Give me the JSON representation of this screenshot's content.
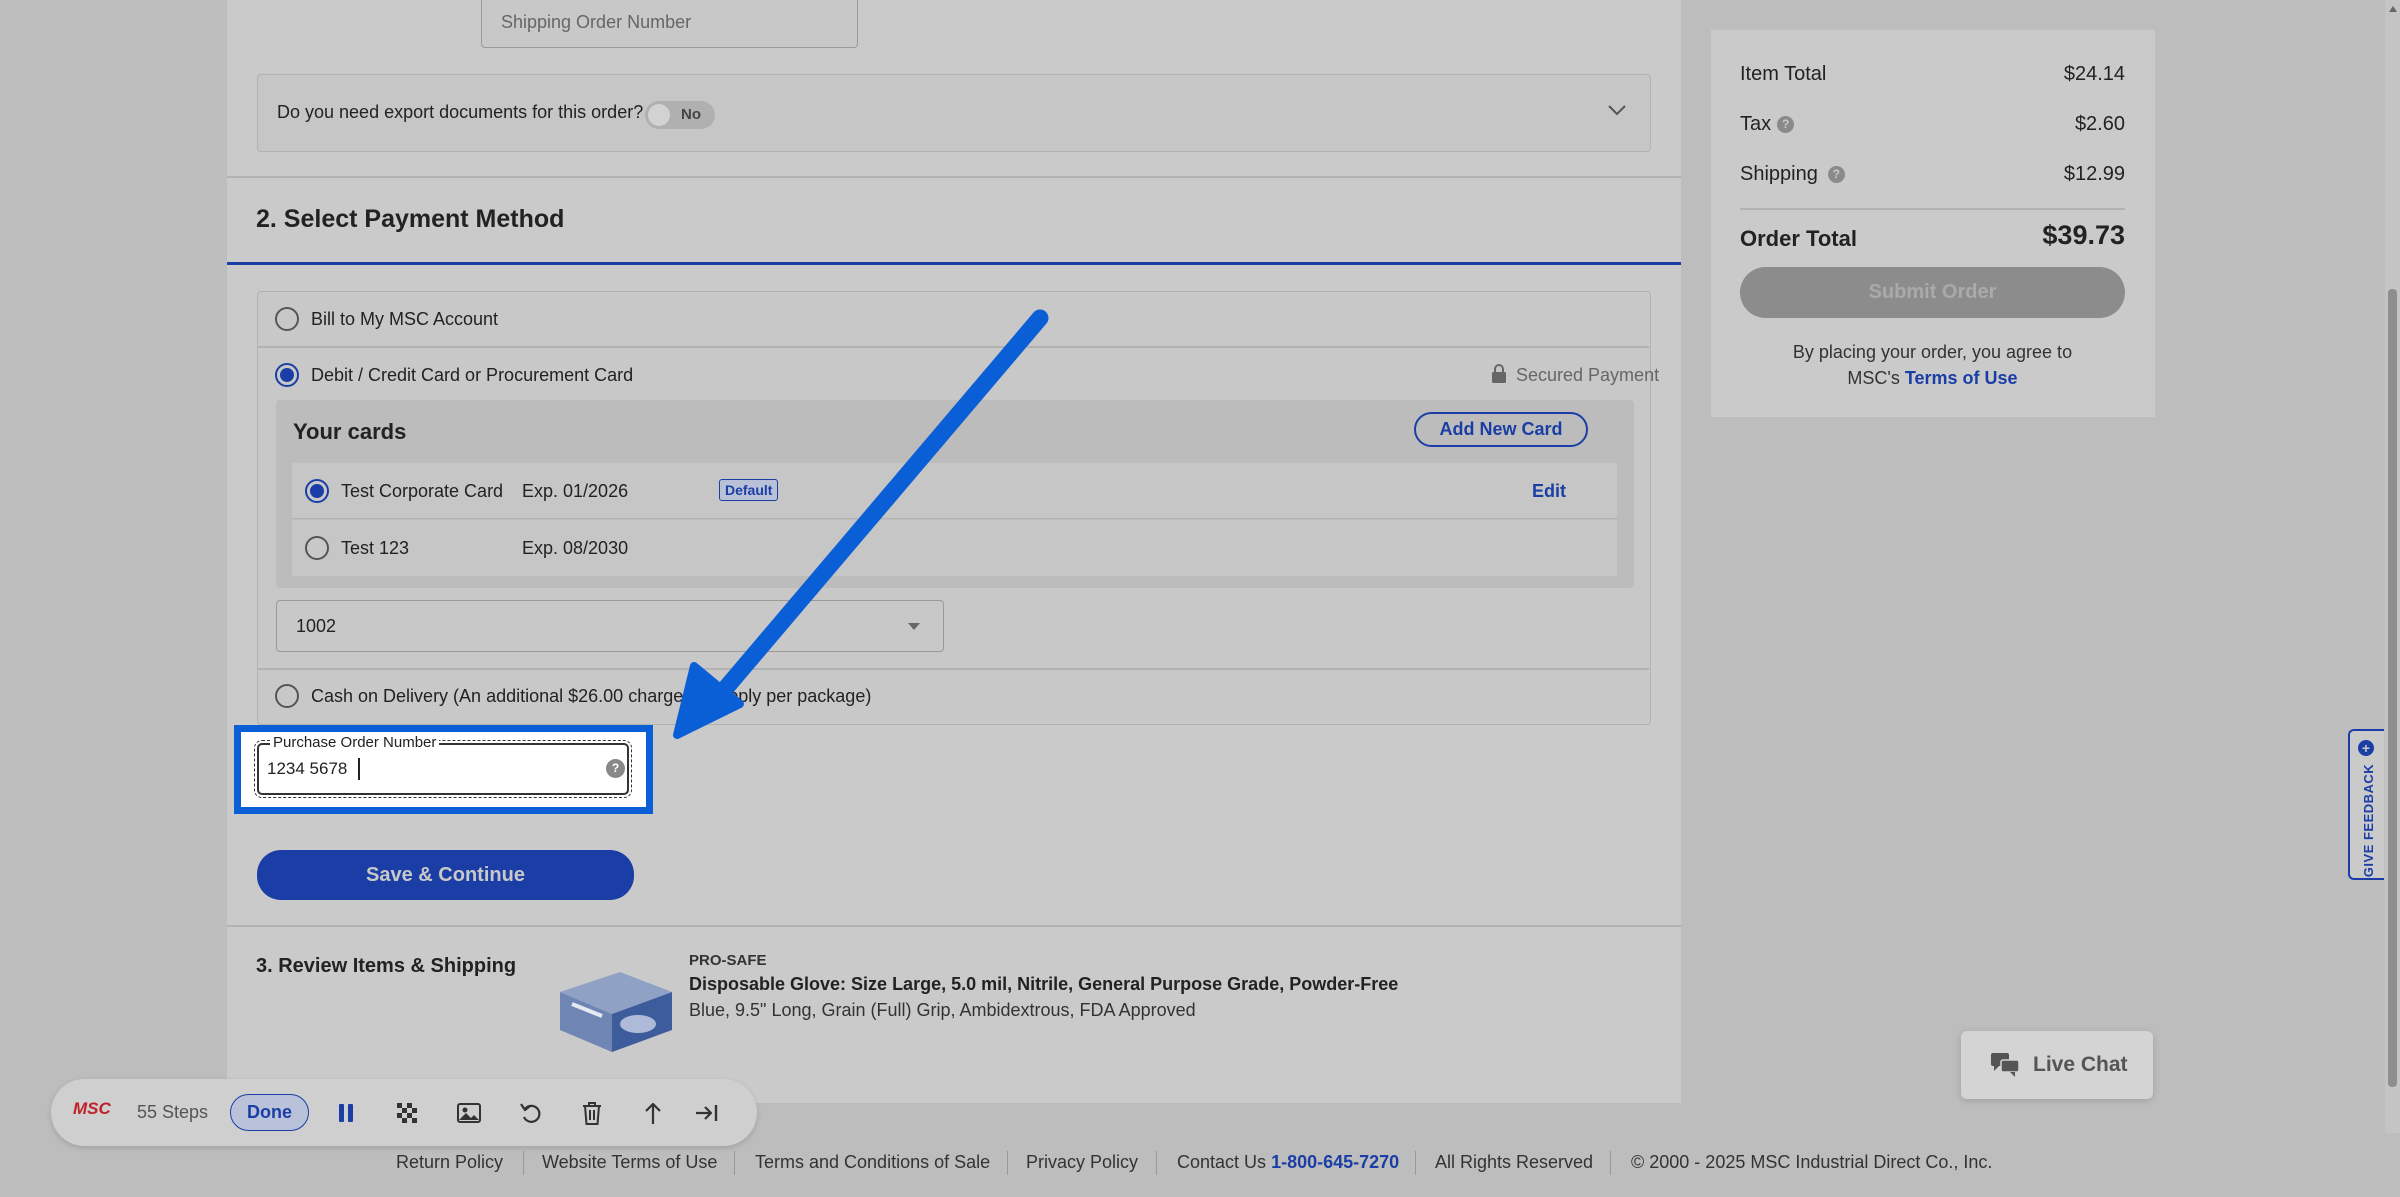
{
  "shipping": {
    "order_number_placeholder": "Shipping Order Number",
    "export_question": "Do you need export documents for this order?",
    "export_toggle": "No"
  },
  "payment": {
    "title": "2. Select Payment Method",
    "options": {
      "bill": "Bill to My MSC Account",
      "card": "Debit / Credit Card or Procurement Card",
      "cod": "Cash on Delivery (An additional $26.00 charge will apply per package)"
    },
    "secured": "Secured Payment",
    "your_cards": "Your cards",
    "add_card": "Add New Card",
    "cards": [
      {
        "name": "Test Corporate Card",
        "exp": "Exp. 01/2026",
        "badge": "Default",
        "action": "Edit"
      },
      {
        "name": "Test 123",
        "exp": "Exp. 08/2030"
      }
    ],
    "select_value": "1002",
    "po_label": "Purchase Order Number",
    "po_value": "1234 5678 ",
    "save_button": "Save & Continue"
  },
  "review": {
    "title": "3. Review Items & Shipping",
    "brand": "PRO-SAFE",
    "product": "Disposable Glove: Size Large, 5.0 mil, Nitrile, General Purpose Grade, Powder-Free",
    "details": "Blue, 9.5\" Long, Grain (Full) Grip, Ambidextrous, FDA Approved"
  },
  "summary": {
    "item_total_label": "Item Total",
    "item_total": "$24.14",
    "tax_label": "Tax",
    "tax": "$2.60",
    "shipping_label": "Shipping",
    "shipping": "$12.99",
    "order_total_label": "Order Total",
    "order_total": "$39.73",
    "submit": "Submit Order",
    "agree_line1": "By placing your order, you agree to",
    "agree_prefix": "MSC's ",
    "terms_link": "Terms of Use"
  },
  "footer": {
    "links": [
      "Return Policy",
      "Website Terms of Use",
      "Terms and Conditions of Sale",
      "Privacy Policy"
    ],
    "contact_label": "Contact Us",
    "phone": "1-800-645-7270",
    "rights": "All Rights Reserved",
    "copyright": "© 2000 - 2025 MSC Industrial Direct Co., Inc."
  },
  "recorder": {
    "logo": "MSC",
    "steps": "55 Steps",
    "done": "Done",
    "icons": [
      "pause-icon",
      "blur-icon",
      "image-icon",
      "undo-icon",
      "trash-icon",
      "export-icon",
      "skip-icon"
    ]
  },
  "feedback_tab": "GIVE FEEDBACK",
  "livechat": "Live Chat",
  "colors": {
    "accent": "#1a3ea6",
    "annotation": "#0a5fd6"
  }
}
